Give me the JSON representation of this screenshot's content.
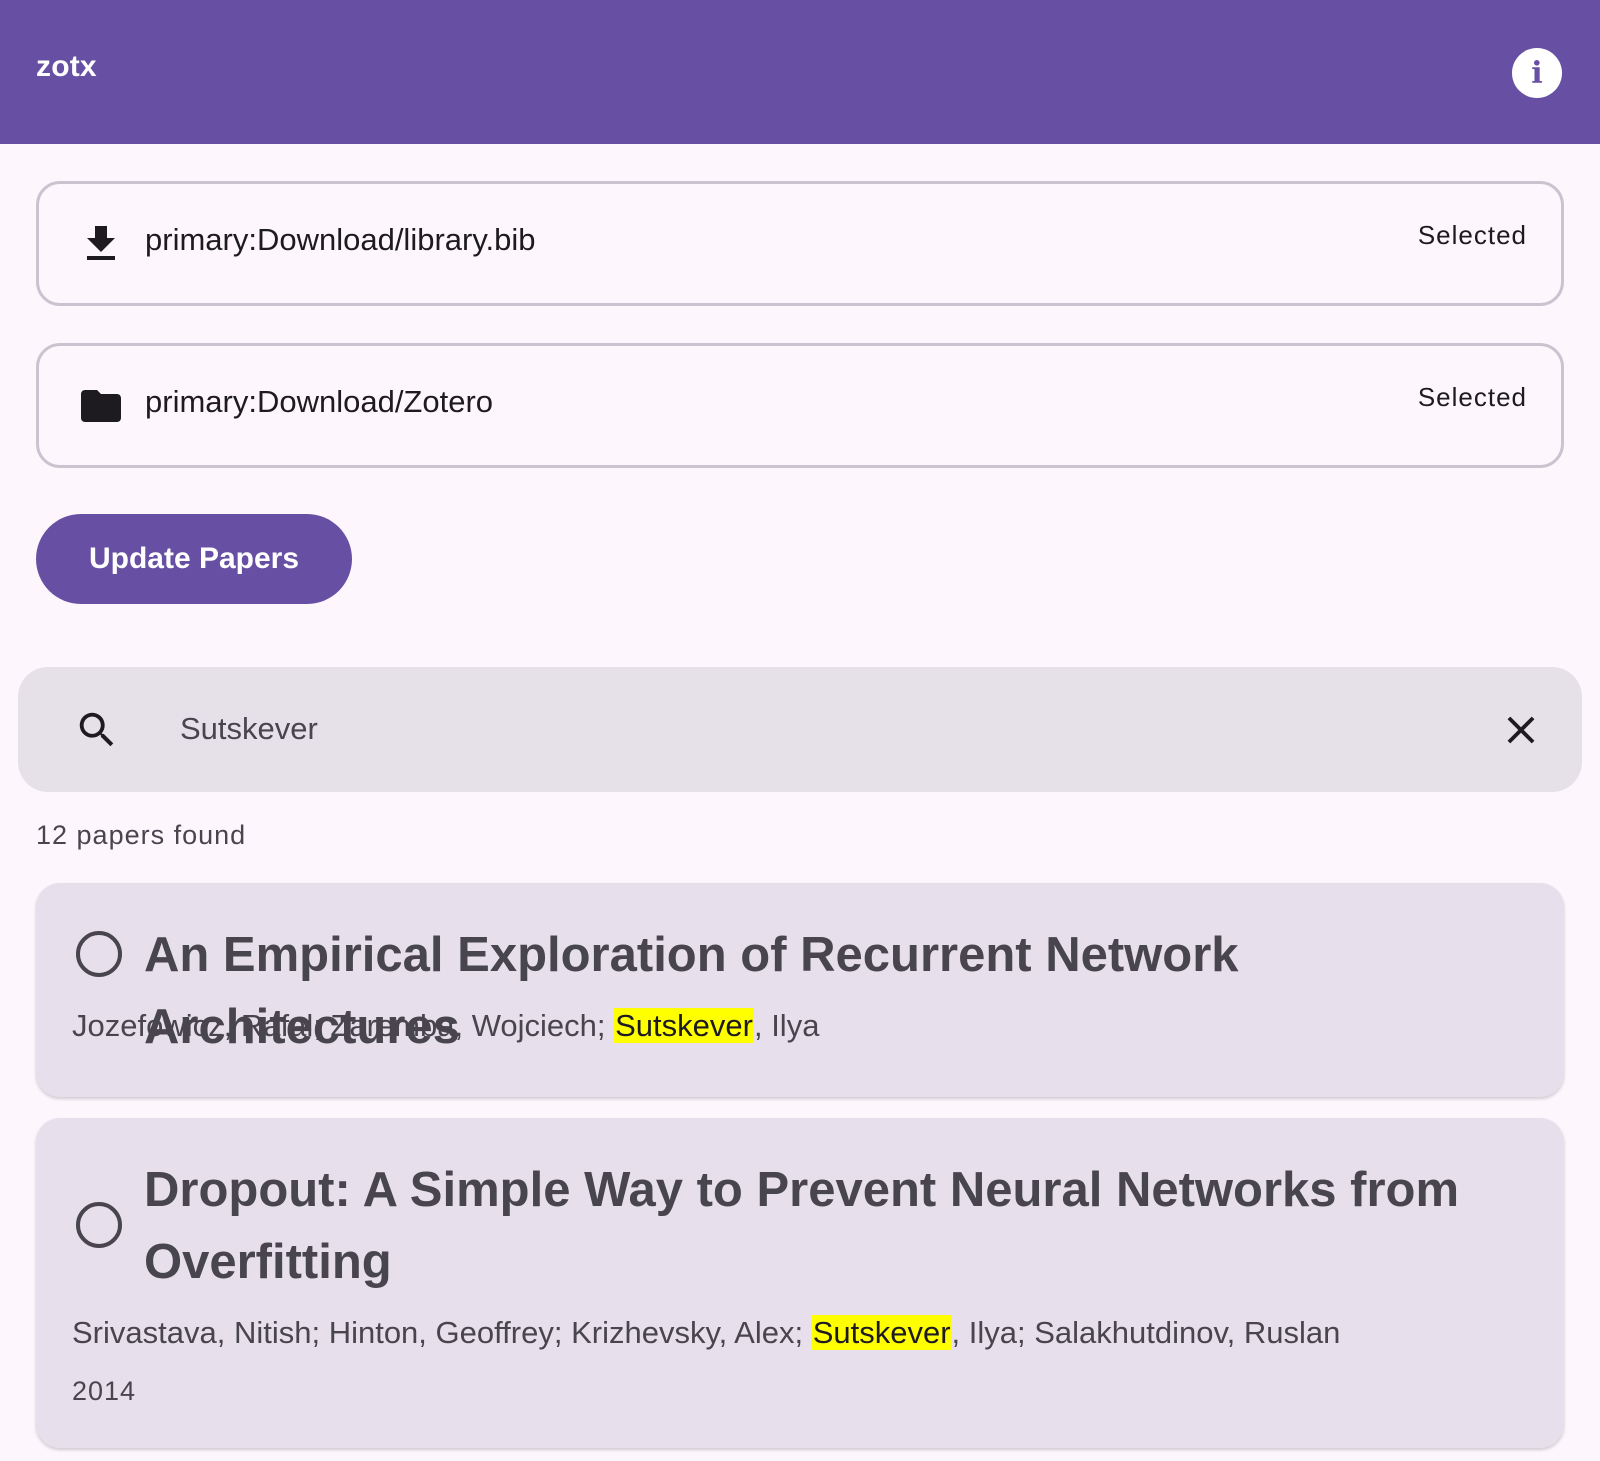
{
  "appbar": {
    "title": "zotx",
    "info_icon": "info-icon",
    "color": "#6750a4"
  },
  "paths": [
    {
      "icon": "download-icon",
      "path": "primary:Download/library.bib",
      "status": "Selected"
    },
    {
      "icon": "folder-icon",
      "path": "primary:Download/Zotero",
      "status": "Selected"
    }
  ],
  "update_button": {
    "label": "Update Papers"
  },
  "search": {
    "value": "Sutskever",
    "search_icon": "search-icon",
    "clear_icon": "close-icon"
  },
  "results": {
    "count_text": "12 papers found"
  },
  "papers": [
    {
      "title": "An Empirical Exploration of Recurrent Network Architectures",
      "authors_before": "Jozefowicz, Rafal; Zaremba, Wojciech; ",
      "authors_highlight": "Sutskever",
      "authors_after": ", Ilya",
      "year": ""
    },
    {
      "title": "Dropout: A Simple Way to Prevent Neural Networks from Overfitting",
      "authors_before": "Srivastava, Nitish; Hinton, Geoffrey; Krizhevsky, Alex; ",
      "authors_highlight": "Sutskever",
      "authors_after": ", Ilya; Salakhutdinov, Ruslan",
      "year": "2014"
    }
  ],
  "highlight_color": "#ffff00"
}
